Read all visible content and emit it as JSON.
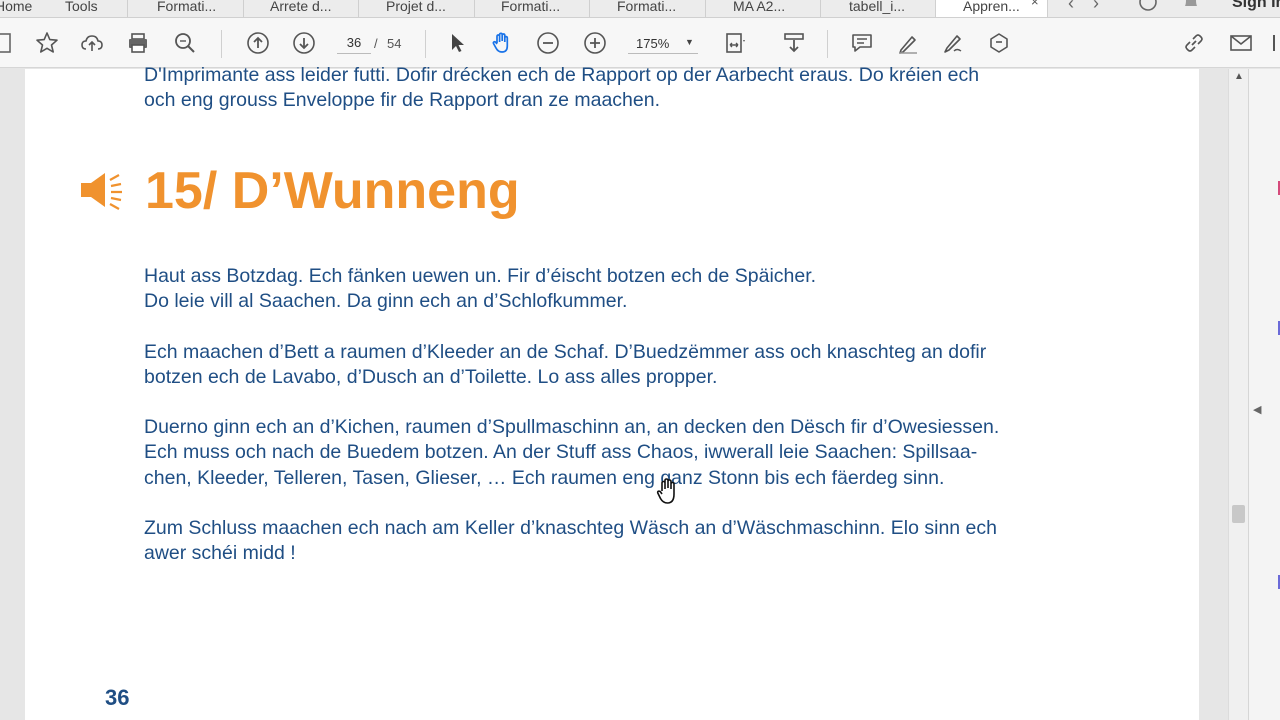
{
  "tabs": [
    {
      "label": "Home",
      "active": false
    },
    {
      "label": "Tools",
      "active": false
    },
    {
      "label": "Formati...",
      "active": false
    },
    {
      "label": "Arrete d...",
      "active": false
    },
    {
      "label": "Projet d...",
      "active": false
    },
    {
      "label": "Formati...",
      "active": false
    },
    {
      "label": "Formati...",
      "active": false
    },
    {
      "label": "MA A2...",
      "active": false
    },
    {
      "label": "tabell_i...",
      "active": false
    },
    {
      "label": "Appren...",
      "active": true
    }
  ],
  "tab_close": "×",
  "nav": {
    "back": "‹",
    "forward": "›"
  },
  "account": {
    "signin_label": "Sign In"
  },
  "toolbar": {
    "page_current": "36",
    "page_separator": "/",
    "page_total": "54",
    "zoom": "175%",
    "zoom_caret": "▼"
  },
  "document": {
    "top_lines": [
      "D'Imprimante ass leider futti. Dofir drécken ech de Rapport op der Aarbecht eraus. Do kréien ech",
      "och eng grouss Enveloppe fir de Rapport dran ze maachen."
    ],
    "heading": "15/ D’Wunneng",
    "paragraphs": [
      [
        "Haut ass Botzdag. Ech fänken uewen un. Fir d’éischt botzen ech de Späicher.",
        "Do leie vill al Saachen. Da ginn ech an d’Schlofkummer."
      ],
      [
        "Ech maachen d’Bett a raumen d’Kleeder an de Schaf. D’Buedzëmmer ass och knaschteg an dofir",
        "botzen ech de Lavabo, d’Dusch an d’Toilette. Lo ass alles propper."
      ],
      [
        "Duerno ginn ech an d’Kichen, raumen d’Spullmaschinn an, an decken den Dësch fir d’Owesiessen.",
        "Ech muss och nach de Buedem botzen. An der Stuff ass Chaos, iwwerall leie Saachen: Spillsaa-",
        "chen, Kleeder, Telleren, Tasen, Glieser, … Ech raumen eng ganz Stonn bis ech fäerdeg sinn."
      ],
      [
        "Zum Schluss maachen ech nach am Keller d’knaschteg Wäsch an d’Wäschmaschinn. Elo sinn ech",
        "awer schéi midd !"
      ]
    ],
    "page_number": "36"
  },
  "scrollbar": {
    "up_arrow": "▲"
  },
  "right_pane": {
    "collapse_arrow": "◀"
  },
  "colors": {
    "heading_orange": "#f0922e",
    "body_blue": "#1f4e84",
    "hand_tool_active": "#1a73e8"
  },
  "icons": {
    "toolbar": [
      "create-pdf-icon",
      "bookmark-star-icon",
      "cloud-upload-icon",
      "print-icon",
      "zoom-search-icon",
      "page-up-icon",
      "page-down-icon",
      "select-arrow-icon",
      "hand-tool-icon",
      "zoom-out-icon",
      "zoom-in-icon",
      "fit-page-icon",
      "scroll-mode-icon",
      "comment-icon",
      "highlight-pen-icon",
      "sign-pen-icon",
      "stamp-icon",
      "share-link-icon",
      "email-icon",
      "more-icon"
    ],
    "document": [
      "speaker-audio-icon",
      "hand-cursor-icon"
    ]
  }
}
